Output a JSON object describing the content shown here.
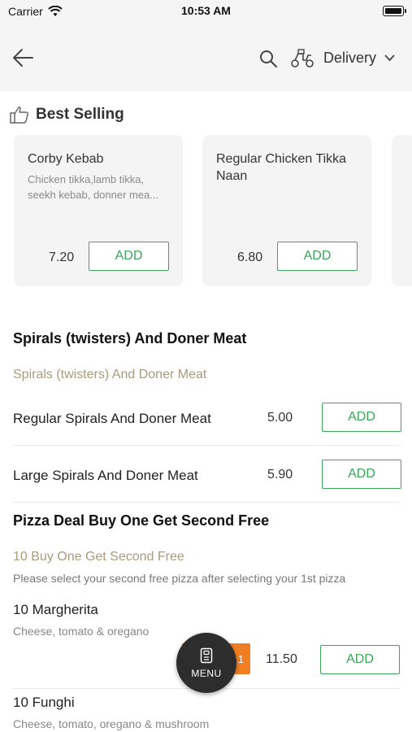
{
  "status_bar": {
    "carrier": "Carrier",
    "time": "10:53 AM"
  },
  "header": {
    "delivery_label": "Delivery"
  },
  "best_selling": {
    "title": "Best Selling",
    "cards": [
      {
        "name": "Corby Kebab",
        "description": "Chicken tikka,lamb tikka, seekh kebab, donner mea...",
        "price": "7.20",
        "add_label": "ADD"
      },
      {
        "name": "Regular Chicken Tikka Naan",
        "description": "",
        "price": "6.80",
        "add_label": "ADD"
      }
    ]
  },
  "section_spirals": {
    "title": "Spirals (twisters) And Doner Meat",
    "subtitle": "Spirals (twisters) And Doner Meat",
    "items": [
      {
        "name": "Regular Spirals And Doner Meat",
        "price": "5.00",
        "add_label": "ADD"
      },
      {
        "name": "Large Spirals And Doner Meat",
        "price": "5.90",
        "add_label": "ADD"
      }
    ]
  },
  "section_pizza": {
    "title": "Pizza Deal Buy One Get Second Free",
    "subtitle": "10 Buy One Get Second Free",
    "note": "Please select your second free pizza after selecting your 1st pizza",
    "items": [
      {
        "name": "10 Margherita",
        "description": "Cheese, tomato & oregano",
        "price": "11.50",
        "add_label": "ADD",
        "badge": "t 1"
      },
      {
        "name": "10 Funghi",
        "description": "Cheese, tomato, oregano & mushroom"
      }
    ]
  },
  "fab": {
    "label": "MENU"
  },
  "colors": {
    "accent_green": "#3aa65a",
    "badge_orange": "#ef7f22",
    "subtitle_tan": "#a99a7c"
  }
}
